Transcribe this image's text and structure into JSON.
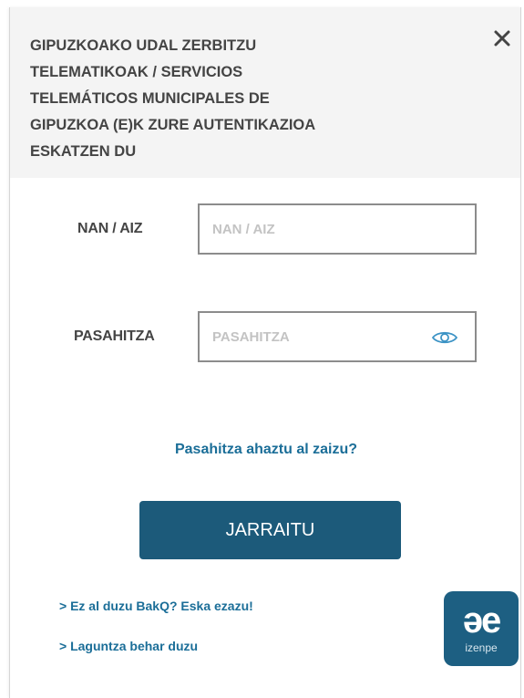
{
  "header": {
    "title": "GIPUZKOAKO UDAL ZERBITZU\nTELEMATIKOAK / SERVICIOS\nTELEMÁTICOS MUNICIPALES DE\nGIPUZKOA  (E)K ZURE AUTENTIKAZIOA\nESKATZEN DU",
    "close_icon": "close-icon"
  },
  "form": {
    "nan": {
      "label": "NAN / AIZ",
      "placeholder": "NAN / AIZ",
      "value": ""
    },
    "password": {
      "label": "PASAHITZA",
      "placeholder": "PASAHITZA",
      "value": "",
      "icon": "eye-icon"
    },
    "forgot_link": "Pasahitza ahaztu al zaizu?",
    "submit_label": "JARRAITU"
  },
  "footer": {
    "links": [
      "> Ez al duzu BakQ? Eska ezazu!",
      "> Laguntza behar duzu"
    ],
    "logo": {
      "mark": "əe",
      "text": "izenpe"
    }
  },
  "colors": {
    "accent": "#1c5a7a",
    "link": "#1b6e98",
    "header_bg": "#f4f4f4",
    "field_border": "#8c8c8c"
  }
}
